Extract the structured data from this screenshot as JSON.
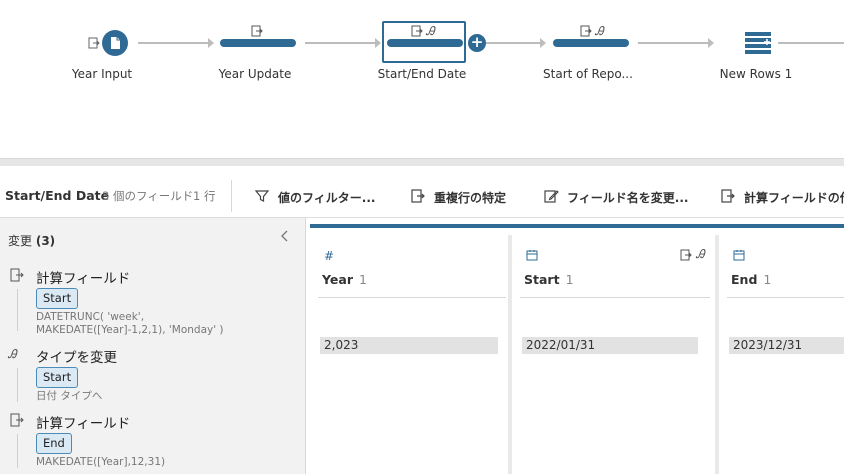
{
  "flow": {
    "nodes": [
      {
        "label": "Year Input",
        "type": "input"
      },
      {
        "label": "Year Update",
        "type": "clean"
      },
      {
        "label": "Start/End Date",
        "type": "clean",
        "selected": true
      },
      {
        "label": "Start of Repo...",
        "type": "clean"
      },
      {
        "label": "New Rows 1",
        "type": "new-rows"
      }
    ],
    "accent": "#2e6a94",
    "add_step_symbol": "+"
  },
  "toolbar": {
    "step_name": "Start/End Date",
    "field_count": "3 個のフィールド",
    "row_count": "1 行",
    "buttons": [
      {
        "label": "値のフィルター...",
        "icon": "filter-icon"
      },
      {
        "label": "重複行の特定",
        "icon": "duplicate-icon"
      },
      {
        "label": "フィールド名を変更...",
        "icon": "rename-icon"
      },
      {
        "label": "計算フィールドの作",
        "icon": "calc-field-icon"
      }
    ]
  },
  "changes": {
    "header": "変更",
    "count": "(3)",
    "items": [
      {
        "title": "計算フィールド",
        "field": "Start",
        "description": "DATETRUNC( 'week',",
        "description2": "MAKEDATE([Year]-1,2,1), 'Monday' )",
        "icon": "calc-field-icon"
      },
      {
        "title": "タイプを変更",
        "field": "Start",
        "description": "日付 タイプへ",
        "icon": "type-change-icon"
      },
      {
        "title": "計算フィールド",
        "field": "End",
        "description": "MAKEDATE([Year],12,31)",
        "icon": "calc-field-icon"
      }
    ]
  },
  "grid": {
    "columns": [
      {
        "name": "Year",
        "count": "1",
        "type_icon": "#",
        "value": "2,023"
      },
      {
        "name": "Start",
        "count": "1",
        "type_icon": "calendar-icon",
        "value": "2022/01/31"
      },
      {
        "name": "End",
        "count": "1",
        "type_icon": "calendar-icon",
        "value": "2023/12/31"
      }
    ]
  }
}
